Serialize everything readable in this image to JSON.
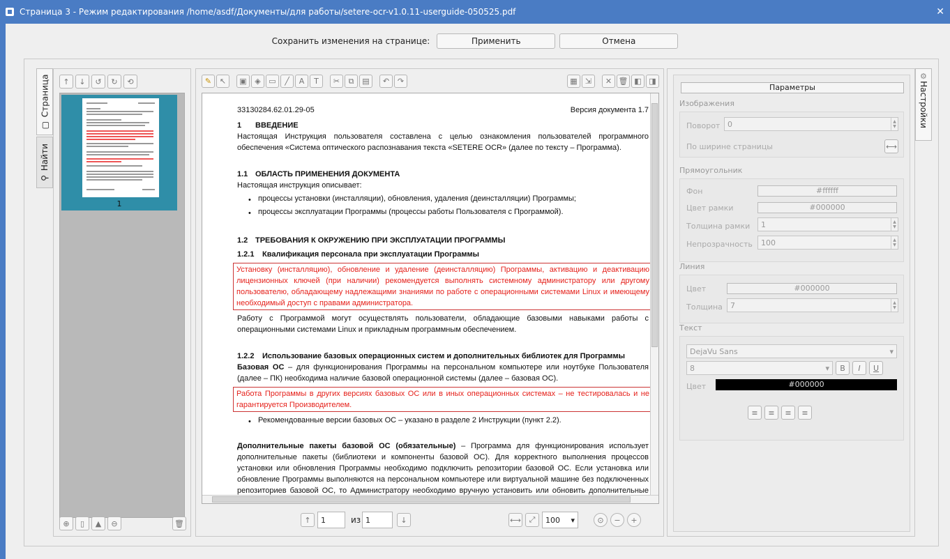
{
  "window": {
    "title": "Страница 3 - Режим редактирования /home/asdf/Документы/для работы/setere-ocr-v1.0.11-userguide-050525.pdf"
  },
  "savebar": {
    "label": "Сохранить изменения на странице:",
    "apply": "Применить",
    "cancel": "Отмена"
  },
  "left_tabs": {
    "page": "Страница",
    "find": "Найти"
  },
  "thumbnail": {
    "page_number": "1"
  },
  "document": {
    "doc_code": "33130284.62.01.29-05",
    "doc_version": "Версия документа 1.7",
    "s1_num": "1",
    "s1_title": "ВВЕДЕНИЕ",
    "s1_text": "Настоящая Инструкция пользователя составлена с целью ознакомления пользователей программного обеспечения «Система оптического распознавания текста «SETERE OCR» (далее по тексту – Программа).",
    "s11_num": "1.1",
    "s11_title": "ОБЛАСТЬ ПРИМЕНЕНИЯ ДОКУМЕНТА",
    "s11_intro": "Настоящая инструкция описывает:",
    "s11_b1": "процессы установки (инсталляции), обновления, удаления (деинсталляции) Программы;",
    "s11_b2": "процессы эксплуатации Программы (процессы работы Пользователя с Программой).",
    "s12_num": "1.2",
    "s12_title": "ТРЕБОВАНИЯ К ОКРУЖЕНИЮ ПРИ ЭКСПЛУАТАЦИИ ПРОГРАММЫ",
    "s121_num": "1.2.1",
    "s121_title": "Квалификация персонала при эксплуатации Программы",
    "s121_red": "Установку (инсталляцию), обновление и удаление (деинсталляцию) Программы, активацию и деактивацию лицензионных ключей (при наличии) рекомендуется выполнять системному администратору или другому пользователю, обладающему надлежащими знаниями по работе с операционными системами Linux и имеющему необходимый доступ с правами администратора.",
    "s121_text": "Работу с Программой могут осуществлять пользователи, обладающие базовыми навыками работы с операционными системами Linux и прикладным программным обеспечением.",
    "s122_num": "1.2.2",
    "s122_title": "Использование базовых операционных систем и дополнительных библиотек для Программы",
    "s122_bold": "Базовая ОС",
    "s122_text": " – для функционирования Программы на персональном компьютере или ноутбуке Пользователя (далее – ПК) необходима наличие базовой операционной системы (далее – базовая ОС).",
    "s122_red": "Работа Программы в других версиях базовых ОС или в иных операционных системах – не тестировалась и не гарантируется Производителем.",
    "s122_b1": "Рекомендованные версии базовых ОС – указано в разделе 2 Инструкции (пункт 2.2).",
    "s122_p2_bold": "Дополнительные пакеты базовой ОС (обязательные)",
    "s122_p2": " – Программа для функционирования использует дополнительные пакеты (библиотеки и компоненты базовой ОС). Для корректного выполнения процессов установки или обновления Программы необходимо подключить репозитории базовой ОС. Если установка или обновление Программы выполняются на персональном компьютере или виртуальной машине без подключенных репозиториев базовой ОС, то Администратору необходимо вручную установить или обновить дополнительные пакеты."
  },
  "pager": {
    "current": "1",
    "of": "из",
    "total": "1",
    "zoom": "100"
  },
  "settings": {
    "header": "Параметры",
    "images": "Изображения",
    "rotation_label": "Поворот",
    "rotation_value": "0",
    "fit_width": "По ширине страницы",
    "rectangle": "Прямоугольник",
    "fill_label": "Фон",
    "fill_value": "#ffffff",
    "border_color_label": "Цвет рамки",
    "border_color_value": "#000000",
    "border_width_label": "Толщина рамки",
    "border_width_value": "1",
    "opacity_label": "Непрозрачность",
    "opacity_value": "100",
    "line": "Линия",
    "line_color_label": "Цвет",
    "line_color_value": "#000000",
    "line_width_label": "Толщина",
    "line_width_value": "7",
    "text": "Текст",
    "font_value": "DejaVu Sans",
    "font_size_value": "8",
    "text_color_label": "Цвет",
    "text_color_value": "#000000"
  },
  "right_tab": {
    "label": "Настройки"
  },
  "colors": {
    "accent": "#4a7cc4",
    "highlight_red": "#e5211b",
    "thumb_selection": "#2f8ea8"
  }
}
